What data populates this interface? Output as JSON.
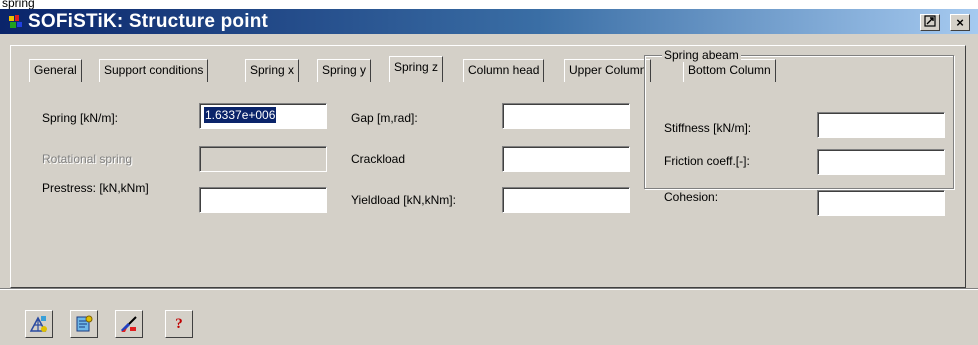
{
  "window": {
    "top_strip_text": "spring",
    "title": "SOFiSTiK: Structure point",
    "pin_button": "⊡",
    "close_button": "×"
  },
  "tabs": [
    {
      "label": "General"
    },
    {
      "label": "Support conditions"
    },
    {
      "label": "Spring x"
    },
    {
      "label": "Spring y"
    },
    {
      "label": "Spring z"
    },
    {
      "label": "Column head"
    },
    {
      "label": "Upper Column"
    },
    {
      "label": "Bottom Column"
    }
  ],
  "active_tab": "Spring z",
  "form": {
    "spring": {
      "label": "Spring [kN/m]:",
      "value": "1.6337e+006"
    },
    "rotational_spring": {
      "label": "Rotational spring",
      "value": ""
    },
    "prestress": {
      "label": "Prestress: [kN,kNm]",
      "value": ""
    },
    "gap": {
      "label": "Gap [m,rad]:",
      "value": ""
    },
    "crackload": {
      "label": "Crackload",
      "value": ""
    },
    "yieldload": {
      "label": "Yieldload [kN,kNm]:",
      "value": ""
    }
  },
  "spring_abeam": {
    "title": "Spring abeam",
    "stiffness": {
      "label": "Stiffness [kN/m]:",
      "value": ""
    },
    "friction": {
      "label": "Friction coeff.[-]:",
      "value": ""
    },
    "cohesion": {
      "label": "Cohesion:",
      "value": ""
    }
  },
  "toolbar": {
    "icons": [
      "structure-edit-icon",
      "settings-icon",
      "brush-icon",
      "help-icon"
    ],
    "help_glyph": "?"
  },
  "colors": {
    "titlebar_start": "#0a246a",
    "titlebar_end": "#a6caf0",
    "face": "#d4d0c8",
    "selection": "#0a246a"
  }
}
